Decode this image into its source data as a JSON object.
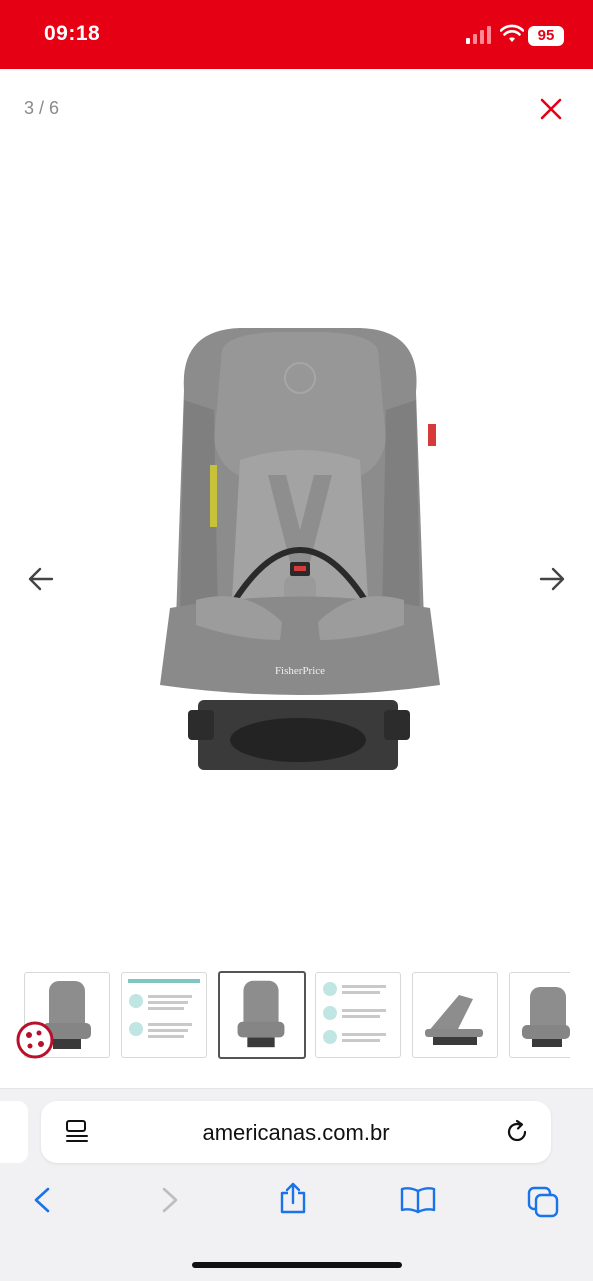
{
  "status_bar": {
    "time": "09:18",
    "battery": "95"
  },
  "gallery": {
    "counter": "3 / 6",
    "main_image": "car-seat-photo",
    "brand_on_seat": "FisherPrice",
    "thumbnails": [
      {
        "image": "car-seat-front",
        "active": false
      },
      {
        "image": "feature-info-sheet",
        "active": false
      },
      {
        "image": "car-seat-front",
        "active": true
      },
      {
        "image": "feature-info-sheet",
        "active": false
      },
      {
        "image": "car-seat-side",
        "active": false
      },
      {
        "image": "car-seat-angle",
        "active": false
      }
    ]
  },
  "browser": {
    "url": "americanas.com.br"
  },
  "colors": {
    "brand_red": "#e60014",
    "ios_blue": "#1a73e8"
  }
}
